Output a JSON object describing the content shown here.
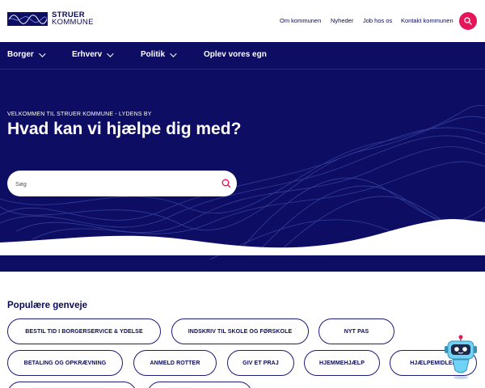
{
  "header": {
    "logo_line1": "STRUER",
    "logo_line2": "KOMMUNE",
    "links": [
      "Om kommunen",
      "Nyheder",
      "Job hos os",
      "Kontakt kommunen"
    ],
    "search_icon": "search-icon"
  },
  "nav": {
    "items": [
      {
        "label": "Borger",
        "has_dropdown": true
      },
      {
        "label": "Erhverv",
        "has_dropdown": true
      },
      {
        "label": "Politik",
        "has_dropdown": true
      },
      {
        "label": "Oplev vores egn",
        "has_dropdown": false
      }
    ]
  },
  "hero": {
    "kicker": "VELKOMMEN TIL STRUER KOMMUNE - LYDENS BY",
    "headline": "Hvad kan vi hjælpe dig med?",
    "search_placeholder": "Søg",
    "search_value": ""
  },
  "shortcuts": {
    "title": "Populære genveje",
    "items": [
      "BESTIL TID I BORGERSERVICE & YDELSE",
      "INDSKRIV TIL SKOLE OG FØRSKOLE",
      "NYT PAS",
      "BETALING OG OPKRÆVNING",
      "ANMELD ROTTER",
      "GIV ET PRAJ",
      "HJEMMEHJÆLP",
      "HJÆLPEMIDLER"
    ]
  },
  "colors": {
    "navy": "#0d0d63",
    "accent": "#e6155a",
    "pill_border": "#1b1b7a"
  }
}
